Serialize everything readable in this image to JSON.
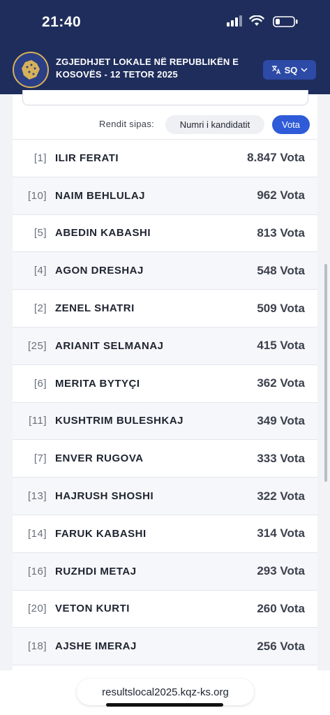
{
  "status_bar": {
    "time": "21:40"
  },
  "header": {
    "title": "ZGJEDHJET LOKALE NË REPUBLIKËN E KOSOVËS - 12 TETOR 2025",
    "language_label": "SQ",
    "colors": {
      "background": "#1f2d5c",
      "lang_button": "#2d4aa6"
    }
  },
  "sort": {
    "label": "Rendit sipas:",
    "options": [
      {
        "label": "Numri i kandidatit",
        "selected": false
      },
      {
        "label": "Vota",
        "selected": true
      }
    ],
    "accent": "#2f5bd8"
  },
  "candidates": [
    {
      "number": "[1]",
      "name": "ILIR FERATI",
      "votes": "8.847 Vota"
    },
    {
      "number": "[10]",
      "name": "NAIM BEHLULAJ",
      "votes": "962 Vota"
    },
    {
      "number": "[5]",
      "name": "ABEDIN KABASHI",
      "votes": "813 Vota"
    },
    {
      "number": "[4]",
      "name": "AGON DRESHAJ",
      "votes": "548 Vota"
    },
    {
      "number": "[2]",
      "name": "ZENEL SHATRI",
      "votes": "509 Vota"
    },
    {
      "number": "[25]",
      "name": "ARIANIT SELMANAJ",
      "votes": "415 Vota"
    },
    {
      "number": "[6]",
      "name": "MERITA BYTYÇI",
      "votes": "362 Vota"
    },
    {
      "number": "[11]",
      "name": "KUSHTRIM BULESHKAJ",
      "votes": "349 Vota"
    },
    {
      "number": "[7]",
      "name": "ENVER RUGOVA",
      "votes": "333 Vota"
    },
    {
      "number": "[13]",
      "name": "HAJRUSH SHOSHI",
      "votes": "322 Vota"
    },
    {
      "number": "[14]",
      "name": "FARUK KABASHI",
      "votes": "314 Vota"
    },
    {
      "number": "[16]",
      "name": "RUZHDI METAJ",
      "votes": "293 Vota"
    },
    {
      "number": "[20]",
      "name": "VETON KURTI",
      "votes": "260 Vota"
    },
    {
      "number": "[18]",
      "name": "AJSHE IMERAJ",
      "votes": "256 Vota"
    }
  ],
  "browser": {
    "url": "resultslocal2025.kqz-ks.org"
  }
}
